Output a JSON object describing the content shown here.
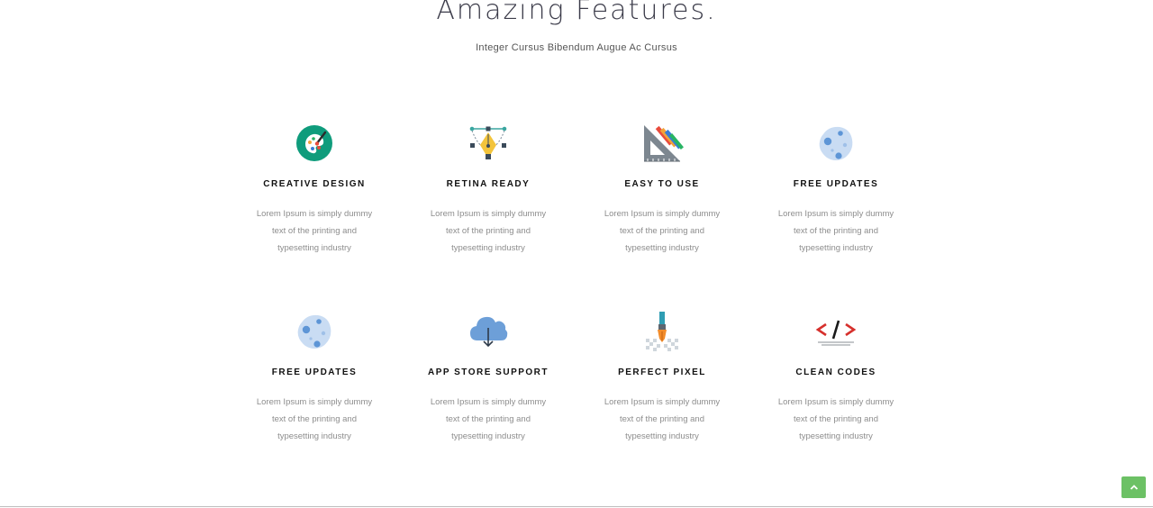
{
  "header": {
    "title": "Amazing Features.",
    "subtitle": "Integer Cursus Bibendum Augue Ac Cursus"
  },
  "features": [
    {
      "title": "CREATIVE DESIGN",
      "description": "Lorem Ipsum is simply dummy text of the printing and typesetting industry",
      "icon": "palette-icon"
    },
    {
      "title": "RETINA READY",
      "description": "Lorem Ipsum is simply dummy text of the printing and typesetting industry",
      "icon": "pen-tool-icon"
    },
    {
      "title": "EASY TO USE",
      "description": "Lorem Ipsum is simply dummy text of the printing and typesetting industry",
      "icon": "set-square-pencils-icon"
    },
    {
      "title": "FREE UPDATES",
      "description": "Lorem Ipsum is simply dummy text of the printing and typesetting industry",
      "icon": "moon-rock-icon"
    },
    {
      "title": "FREE UPDATES",
      "description": "Lorem Ipsum is simply dummy text of the printing and typesetting industry",
      "icon": "moon-rock-icon"
    },
    {
      "title": "APP STORE SUPPORT",
      "description": "Lorem Ipsum is simply dummy text of the printing and typesetting industry",
      "icon": "cloud-download-icon"
    },
    {
      "title": "PERFECT PIXEL",
      "description": "Lorem Ipsum is simply dummy text of the printing and typesetting industry",
      "icon": "pixel-brush-icon"
    },
    {
      "title": "CLEAN CODES",
      "description": "Lorem Ipsum is simply dummy text of the printing and typesetting industry",
      "icon": "code-brackets-icon"
    }
  ],
  "scroll_top": {
    "icon": "chevron-up-icon"
  },
  "colors": {
    "accent_green": "#6cc165",
    "heading": "#3c3c4a",
    "feature_title": "#111111",
    "feature_text": "#8d8d8d"
  }
}
